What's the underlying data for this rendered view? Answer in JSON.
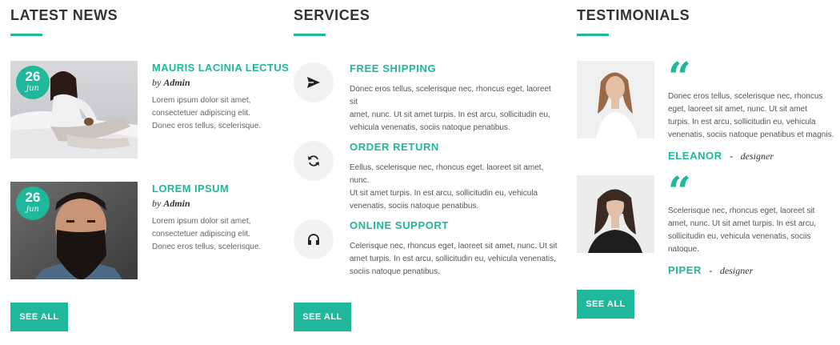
{
  "latest_news": {
    "title": "LATEST NEWS",
    "items": [
      {
        "day": "26",
        "month": "jun",
        "heading": "MAURIS LACINIA LECTUS",
        "by_prefix": "by",
        "author": "Admin",
        "lines": [
          "Lorem ipsum dolor sit amet,",
          "consectetuer adipiscing elit.",
          "Donec eros tellus, scelerisque."
        ]
      },
      {
        "day": "26",
        "month": "jun",
        "heading": "LOREM IPSUM",
        "by_prefix": "by",
        "author": "Admin",
        "lines": [
          "Lorem ipsum dolor sit amet,",
          "consectetuer adipiscing elit.",
          "Donec eros tellus, scelerisque."
        ]
      }
    ],
    "see_all": "SEE ALL"
  },
  "services": {
    "title": "SERVICES",
    "items": [
      {
        "icon": "paper-plane-icon",
        "heading": "FREE SHIPPING",
        "lines": [
          "Donec eros tellus, scelerisque nec, rhoncus eget, laoreet sit",
          "amet, nunc. Ut sit amet turpis. In est arcu, sollicitudin eu,",
          "vehicula venenatis, sociis natoque penatibus."
        ]
      },
      {
        "icon": "refresh-icon",
        "heading": "ORDER RETURN",
        "lines": [
          "Eellus, scelerisque nec, rhoncus eget, laoreet sit amet, nunc.",
          "Ut sit amet turpis. In est arcu, sollicitudin eu, vehicula",
          "venenatis, sociis natoque penatibus."
        ]
      },
      {
        "icon": "headphones-icon",
        "heading": "ONLINE SUPPORT",
        "lines": [
          "Celerisque nec, rhoncus eget, laoreet sit amet, nunc. Ut sit",
          "amet turpis. In est arcu, sollicitudin eu, vehicula venenatis,",
          "sociis natoque penatibus."
        ]
      }
    ],
    "see_all": "SEE ALL"
  },
  "testimonials": {
    "title": "TESTIMONIALS",
    "items": [
      {
        "quote_mark": "“",
        "lines": [
          "Donec eros tellus, scelerisque nec, rhoncus",
          "eget, laoreet sit amet, nunc. Ut sit amet",
          "turpis. In est arcu, sollicitudin eu, vehicula",
          "venenatis, sociis natoque penatibus et magnis."
        ],
        "name": "ELEANOR",
        "separator": "-",
        "role": "designer"
      },
      {
        "quote_mark": "“",
        "lines": [
          "Scelerisque nec, rhoncus eget, laoreet sit",
          "amet, nunc. Ut sit amet turpis. In est arcu,",
          "sollicitudin eu, vehicula venenatis, sociis",
          "natoque."
        ],
        "name": "PIPER",
        "separator": "-",
        "role": "designer"
      }
    ],
    "see_all": "SEE ALL"
  },
  "colors": {
    "accent": "#1fb89a",
    "heading": "#333333",
    "icon_bg": "#f2f2f2"
  }
}
